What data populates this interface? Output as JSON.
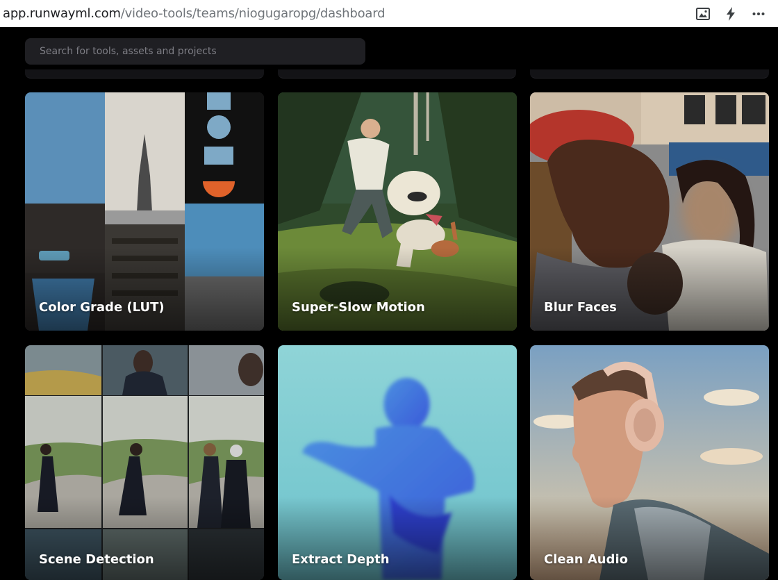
{
  "browser": {
    "url_host": "app.runwayml.com",
    "url_path": "/video-tools/teams/niogugaropg/dashboard",
    "icons": [
      "picture-icon",
      "lightning-icon",
      "more-icon"
    ]
  },
  "search": {
    "placeholder": "Search for tools, assets and projects",
    "icon": "none"
  },
  "tools": [
    {
      "label": "Color Grade (LUT)"
    },
    {
      "label": "Super-Slow Motion"
    },
    {
      "label": "Blur Faces"
    },
    {
      "label": "Scene Detection"
    },
    {
      "label": "Extract Depth"
    },
    {
      "label": "Clean Audio"
    }
  ],
  "colors": {
    "page_bg": "#000000",
    "search_bg": "#1f1f23",
    "label_text": "#ffffff"
  }
}
